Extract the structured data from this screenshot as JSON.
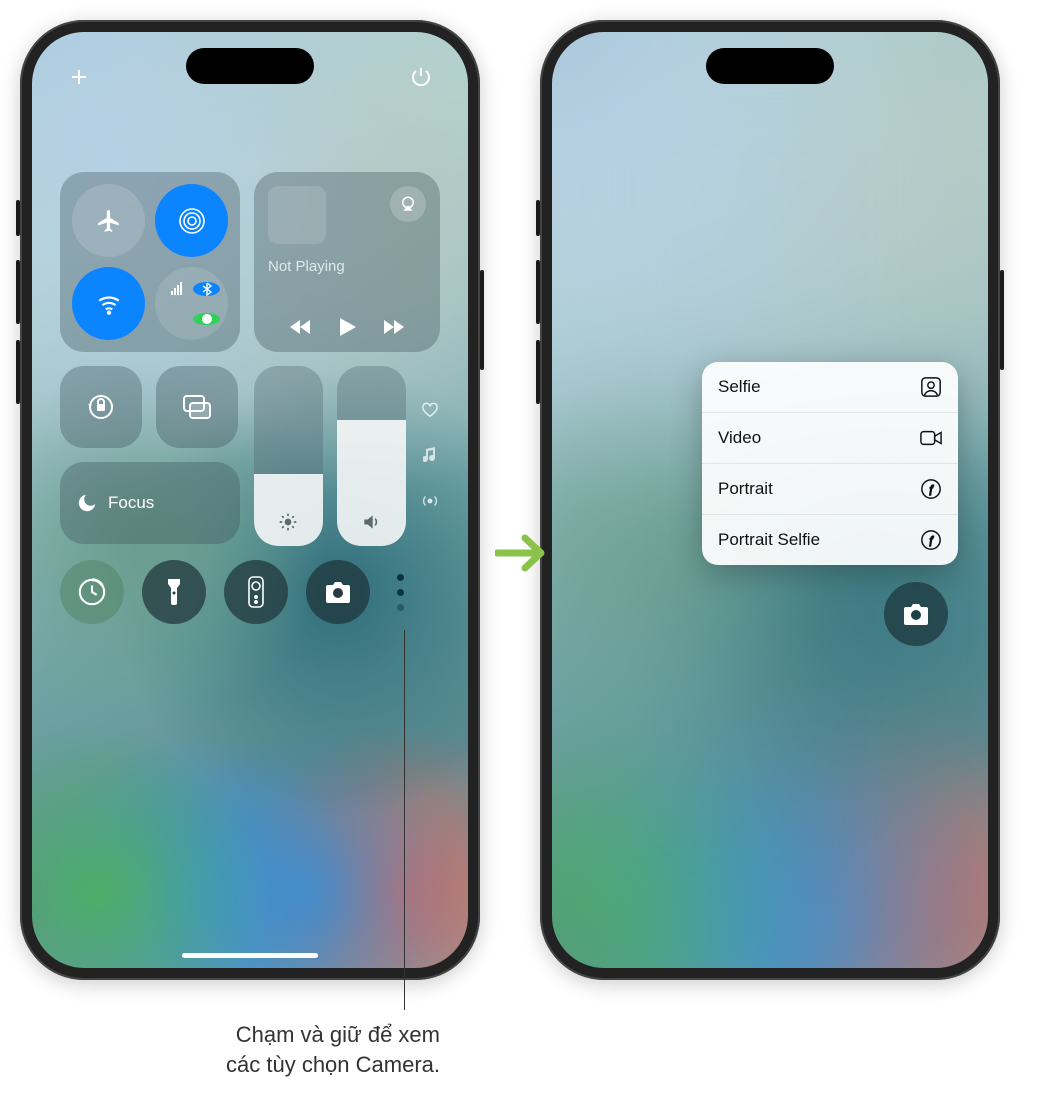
{
  "media": {
    "now_playing": "Not Playing"
  },
  "focus": {
    "label": "Focus"
  },
  "sliders": {
    "brightness_pct": 40,
    "volume_pct": 70
  },
  "context_menu": {
    "items": [
      {
        "label": "Selfie",
        "icon": "person-crop-icon"
      },
      {
        "label": "Video",
        "icon": "video-icon"
      },
      {
        "label": "Portrait",
        "icon": "aperture-icon"
      },
      {
        "label": "Portrait Selfie",
        "icon": "aperture-icon"
      }
    ]
  },
  "caption": {
    "line1": "Chạm và giữ để xem",
    "line2": "các tùy chọn Camera."
  },
  "icons": {
    "plus": "＋",
    "power": "⏻",
    "airplane": "✈",
    "airdrop": "◎",
    "wifi": "ᯤ",
    "cellular": "▮",
    "bluetooth": "ᛒ",
    "airplay": "▲",
    "signal_bars": "▯",
    "lock_rotate": "🔒",
    "mirror": "▭",
    "moon": "☾",
    "sun": "☀",
    "speaker": "🔈",
    "heart": "♡",
    "music": "♪",
    "hotspot": "◉",
    "timer": "◔",
    "flashlight": "🔦",
    "remote": "▮",
    "camera": "📷",
    "rewind": "⏮",
    "play": "▶",
    "forward": "⏭"
  }
}
